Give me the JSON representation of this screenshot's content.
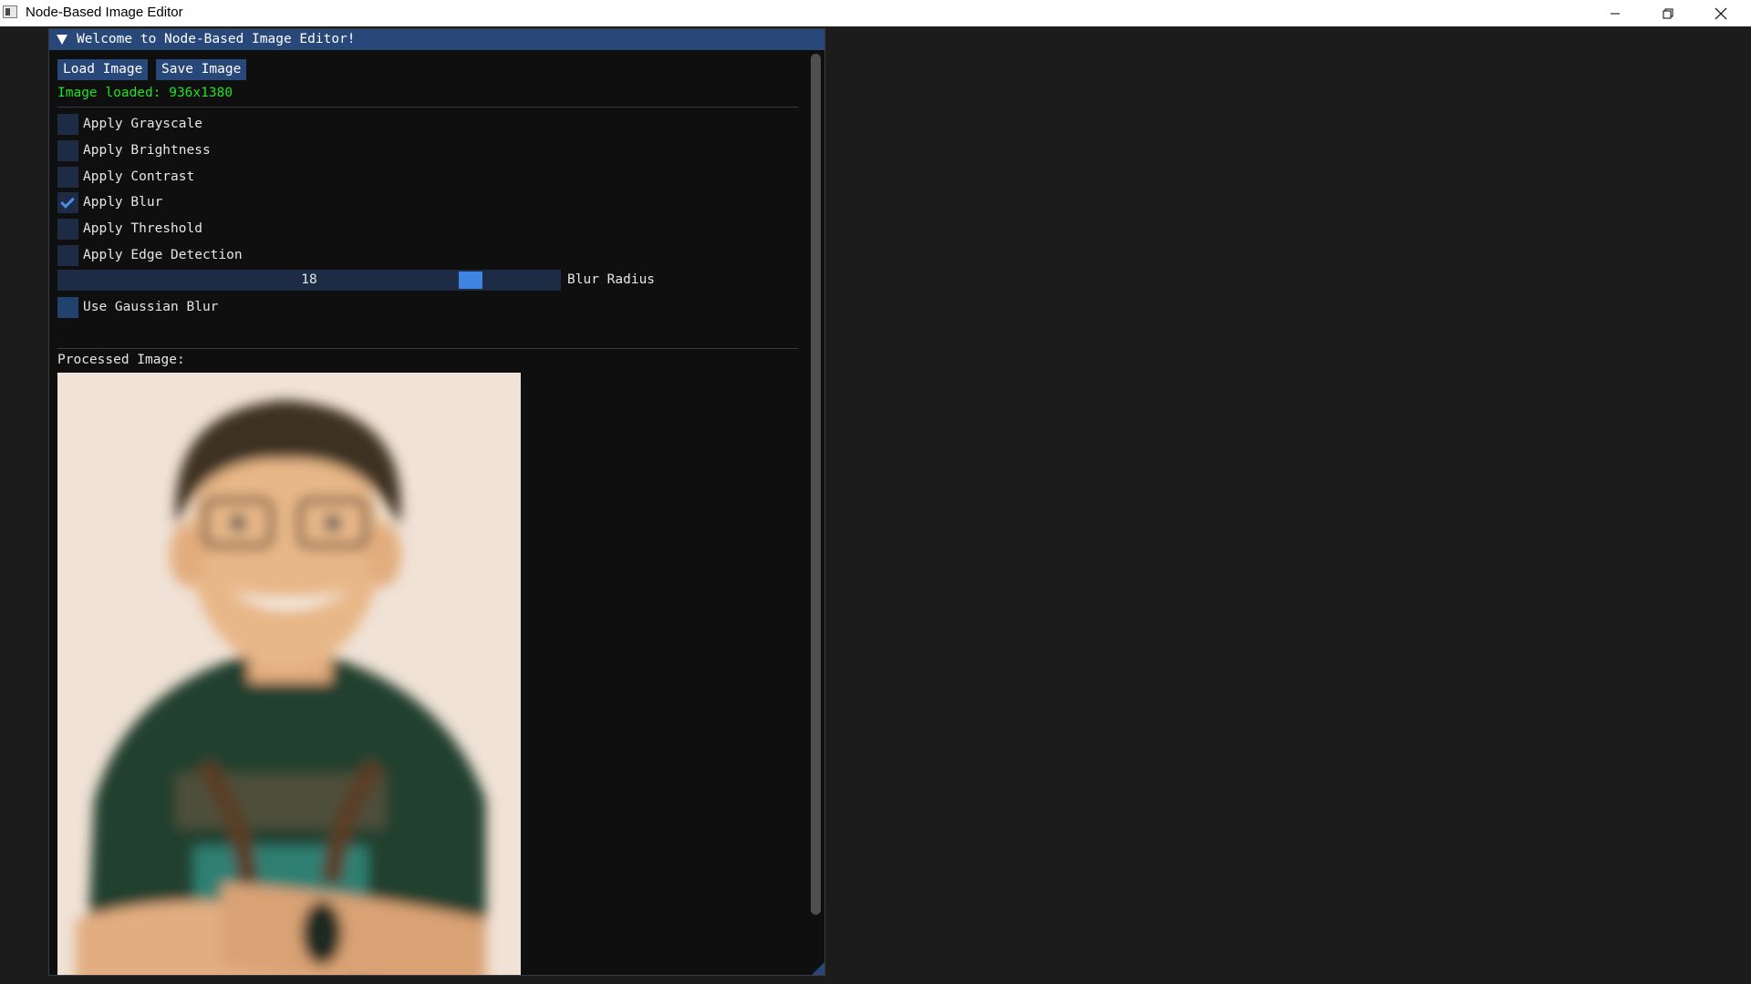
{
  "os_window": {
    "title": "Node-Based Image Editor",
    "icon": "app-icon",
    "controls": [
      "minimize-icon",
      "restore-icon",
      "close-icon"
    ]
  },
  "panel": {
    "header_title": "Welcome to Node-Based Image Editor!",
    "collapse_icon": "triangle-down-icon",
    "buttons": {
      "load": "Load Image",
      "save": "Save Image"
    },
    "status": "Image loaded: 936x1380",
    "filters": [
      {
        "label": "Apply Grayscale",
        "checked": false
      },
      {
        "label": "Apply Brightness",
        "checked": false
      },
      {
        "label": "Apply Contrast",
        "checked": false
      },
      {
        "label": "Apply Blur",
        "checked": true
      },
      {
        "label": "Apply Threshold",
        "checked": false
      },
      {
        "label": "Apply Edge Detection",
        "checked": false
      }
    ],
    "slider": {
      "value": "18",
      "label": "Blur Radius",
      "fraction": 0.84
    },
    "gaussian": {
      "label": "Use Gaussian Blur",
      "checked": false
    },
    "processed_label": "Processed Image:"
  },
  "colors": {
    "accent": "#29487a",
    "slider_grab": "#3d85e0",
    "status_text": "#22e022",
    "window_bg": "#0f0f0f",
    "app_bg": "#1c1c1c"
  }
}
